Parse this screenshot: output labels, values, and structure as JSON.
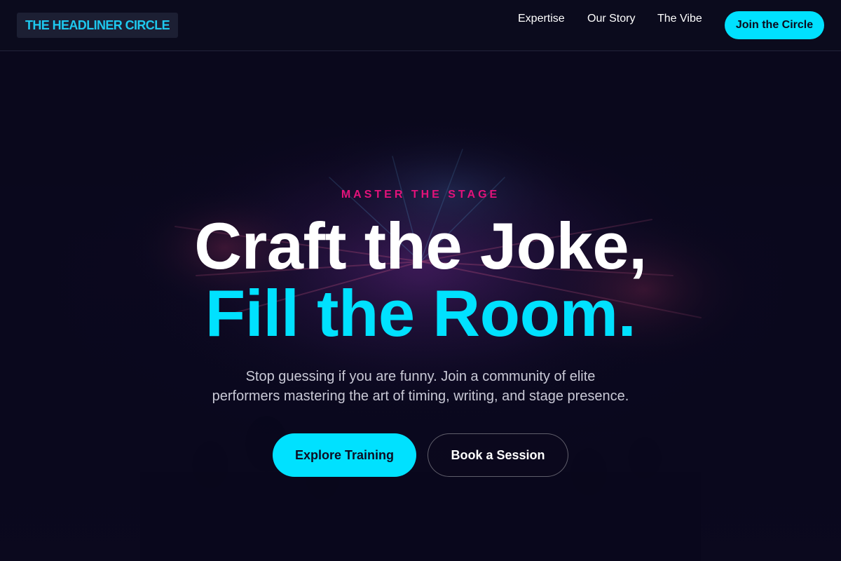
{
  "brand": {
    "logo_text": "THE HEADLINER CIRCLE"
  },
  "nav": {
    "items": [
      {
        "label": "Expertise"
      },
      {
        "label": "Our Story"
      },
      {
        "label": "The Vibe"
      }
    ],
    "cta_label": "Join the Circle"
  },
  "hero": {
    "eyebrow": "MASTER THE STAGE",
    "headline_line1": "Craft the Joke,",
    "headline_line2": "Fill the Room.",
    "subtext": "Stop guessing if you are funny. Join a community of elite performers mastering the art of timing, writing, and stage presence.",
    "primary_cta": "Explore Training",
    "secondary_cta": "Book a Session"
  },
  "colors": {
    "accent_cyan": "#00e1ff",
    "accent_pink": "#e2127a",
    "background": "#0a0818"
  }
}
